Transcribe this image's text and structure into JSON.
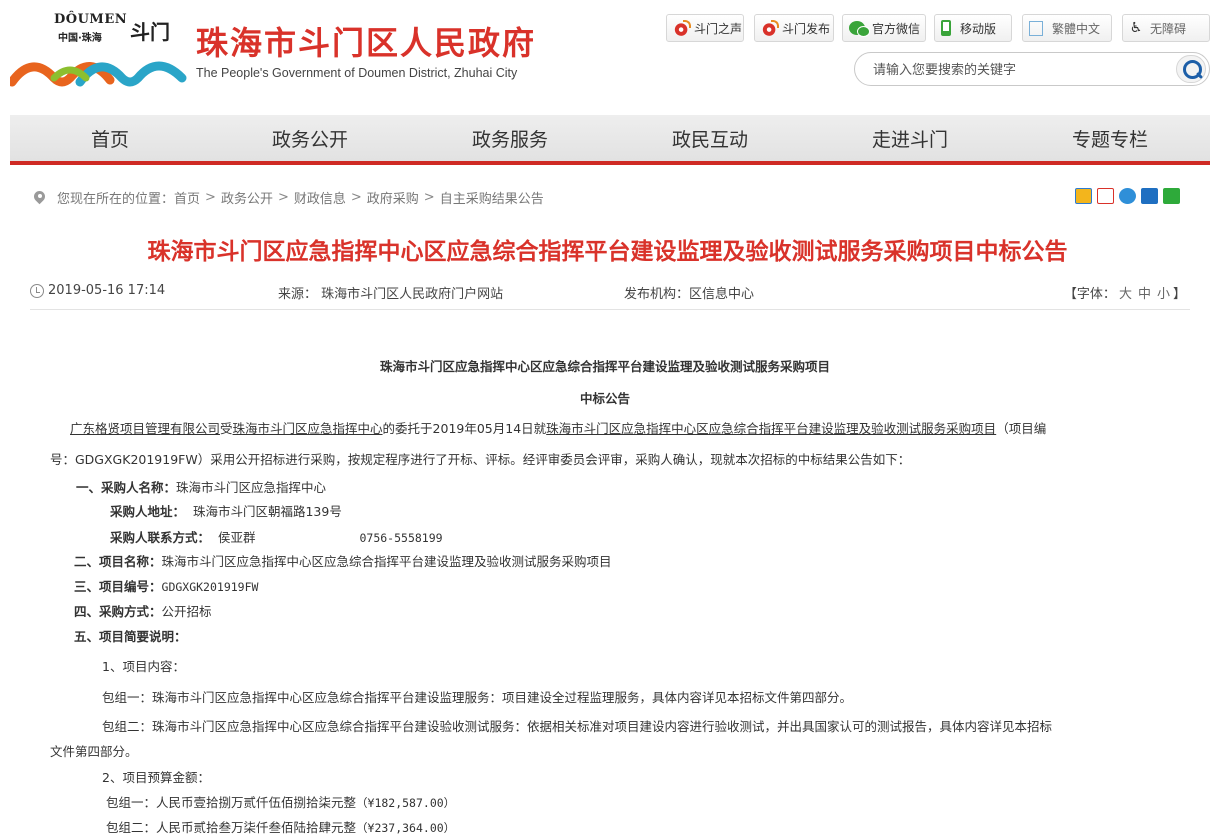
{
  "logo": {
    "en": "DÔUMEN",
    "cn": "中国·珠海",
    "mark": "斗门"
  },
  "site": {
    "title": "珠海市斗门区人民政府",
    "subtitle": "The People's Government of Doumen District, Zhuhai City"
  },
  "toplinks": [
    {
      "label": "斗门之声",
      "icon": "weibo-icon"
    },
    {
      "label": "斗门发布",
      "icon": "weibo-icon"
    },
    {
      "label": "官方微信",
      "icon": "wechat-icon"
    },
    {
      "label": "移动版",
      "icon": "mobile-icon"
    },
    {
      "label": "繁體中文",
      "icon": "traditional-chinese-icon"
    },
    {
      "label": "无障碍",
      "icon": "accessibility-icon"
    }
  ],
  "search": {
    "placeholder": "请输入您要搜索的关键字"
  },
  "nav": [
    "首页",
    "政务公开",
    "政务服务",
    "政民互动",
    "走进斗门",
    "专题专栏"
  ],
  "breadcrumb": {
    "prefix": "您现在所在的位置：",
    "items": [
      "首页",
      "政务公开",
      "财政信息",
      "政府采购",
      "自主采购结果公告"
    ],
    "sep": ">"
  },
  "article": {
    "title": "珠海市斗门区应急指挥中心区应急综合指挥平台建设监理及验收测试服务采购项目中标公告",
    "date": "2019-05-16 17:14",
    "source_label": "来源：",
    "source": "珠海市斗门区人民政府门户网站",
    "org_label": "发布机构：",
    "org": "区信息中心",
    "font_label": "【字体：",
    "font_large": "大",
    "font_medium": "中",
    "font_small": "小",
    "font_close": "】"
  },
  "body": {
    "heading1": "珠海市斗门区应急指挥中心区应急综合指挥平台建设监理及验收测试服务采购项目",
    "heading2": "中标公告",
    "intro_agency": "广东格贤项目管理有限公司",
    "intro_t1": "受",
    "intro_client": "珠海市斗门区应急指挥中心",
    "intro_t2": "的委托于2019年05月14日就",
    "intro_project": "珠海市斗门区应急指挥中心区应急综合指挥平台建设监理及验收测试服务采购项目",
    "intro_t3": "（项目编",
    "intro_line2": "号：GDGXGK201919FW）采用公开招标进行采购，按规定程序进行了开标、评标。经评审委员会评审，采购人确认，现就本次招标的中标结果公告如下：",
    "s1_label": "一、采购人名称：",
    "s1_value": "珠海市斗门区应急指挥中心",
    "addr_label": "采购人地址：",
    "addr_value": "珠海市斗门区朝福路139号",
    "contact_label": "采购人联系方式：",
    "contact_name": "侯亚群",
    "contact_phone": "0756-5558199",
    "s2_label": "二、项目名称：",
    "s2_value": "珠海市斗门区应急指挥中心区应急综合指挥平台建设监理及验收测试服务采购项目",
    "s3_label": "三、项目编号：",
    "s3_value": "GDGXGK201919FW",
    "s4_label": "四、采购方式：",
    "s4_value": "公开招标",
    "s5_label": "五、项目简要说明：",
    "p1": "1、项目内容：",
    "pkg1": "包组一：珠海市斗门区应急指挥中心区应急综合指挥平台建设监理服务：项目建设全过程监理服务，具体内容详见本招标文件第四部分。",
    "pkg2_l1": "包组二：珠海市斗门区应急指挥中心区应急综合指挥平台建设验收测试服务：依据相关标准对项目建设内容进行验收测试，并出具国家认可的测试报告，具体内容详见本招标",
    "pkg2_l2": "文件第四部分。",
    "p2": "2、项目预算金额：",
    "budget1_label": "包组一：人民币壹拾捌万贰仟伍佰捌拾柒元整",
    "budget1_value": "（¥182,587.00）",
    "budget2_label": "包组二：人民币贰拾叁万柒仟叁佰陆拾肆元整",
    "budget2_value": "（¥237,364.00）"
  },
  "colors": {
    "brand_red": "#d9322a",
    "nav_bg": "#e8e8e8"
  }
}
